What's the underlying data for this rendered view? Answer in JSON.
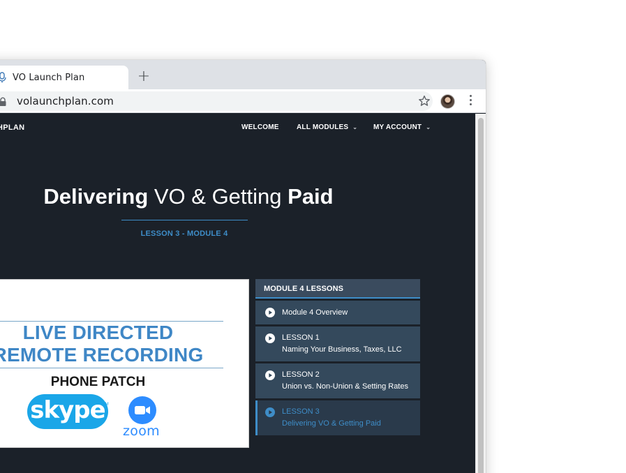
{
  "browser": {
    "tab_title": "VO Launch Plan",
    "new_tab": "+",
    "url": "volaunchplan.com"
  },
  "site": {
    "logo": "HPLAN",
    "nav": [
      {
        "label": "WELCOME"
      },
      {
        "label": "ALL MODULES",
        "chevron": "⌄"
      },
      {
        "label": "MY ACCOUNT",
        "chevron": "⌄"
      }
    ]
  },
  "hero": {
    "title_bold_1": "Delivering",
    "title_light": " VO & Getting ",
    "title_bold_2": "Paid",
    "subtitle": "LESSON 3 - MODULE 4"
  },
  "video": {
    "line1": "LIVE DIRECTED",
    "line2": "REMOTE RECORDING",
    "line3": "PHONE PATCH",
    "skype_label": "skype",
    "skype_tm": "TM",
    "zoom_label": "zoom"
  },
  "lessons": {
    "header": "MODULE 4 LESSONS",
    "items": [
      {
        "line1": "Module 4 Overview",
        "line2": ""
      },
      {
        "line1": "LESSON 1",
        "line2": "Naming Your Business, Taxes, LLC"
      },
      {
        "line1": "LESSON 2",
        "line2": "Union vs. Non-Union & Setting Rates"
      },
      {
        "line1": "LESSON 3",
        "line2": "Delivering VO & Getting Paid",
        "current": true
      }
    ]
  },
  "colors": {
    "accent": "#3e8dc8",
    "page_bg": "#1b2129",
    "panel": "#34495c"
  }
}
